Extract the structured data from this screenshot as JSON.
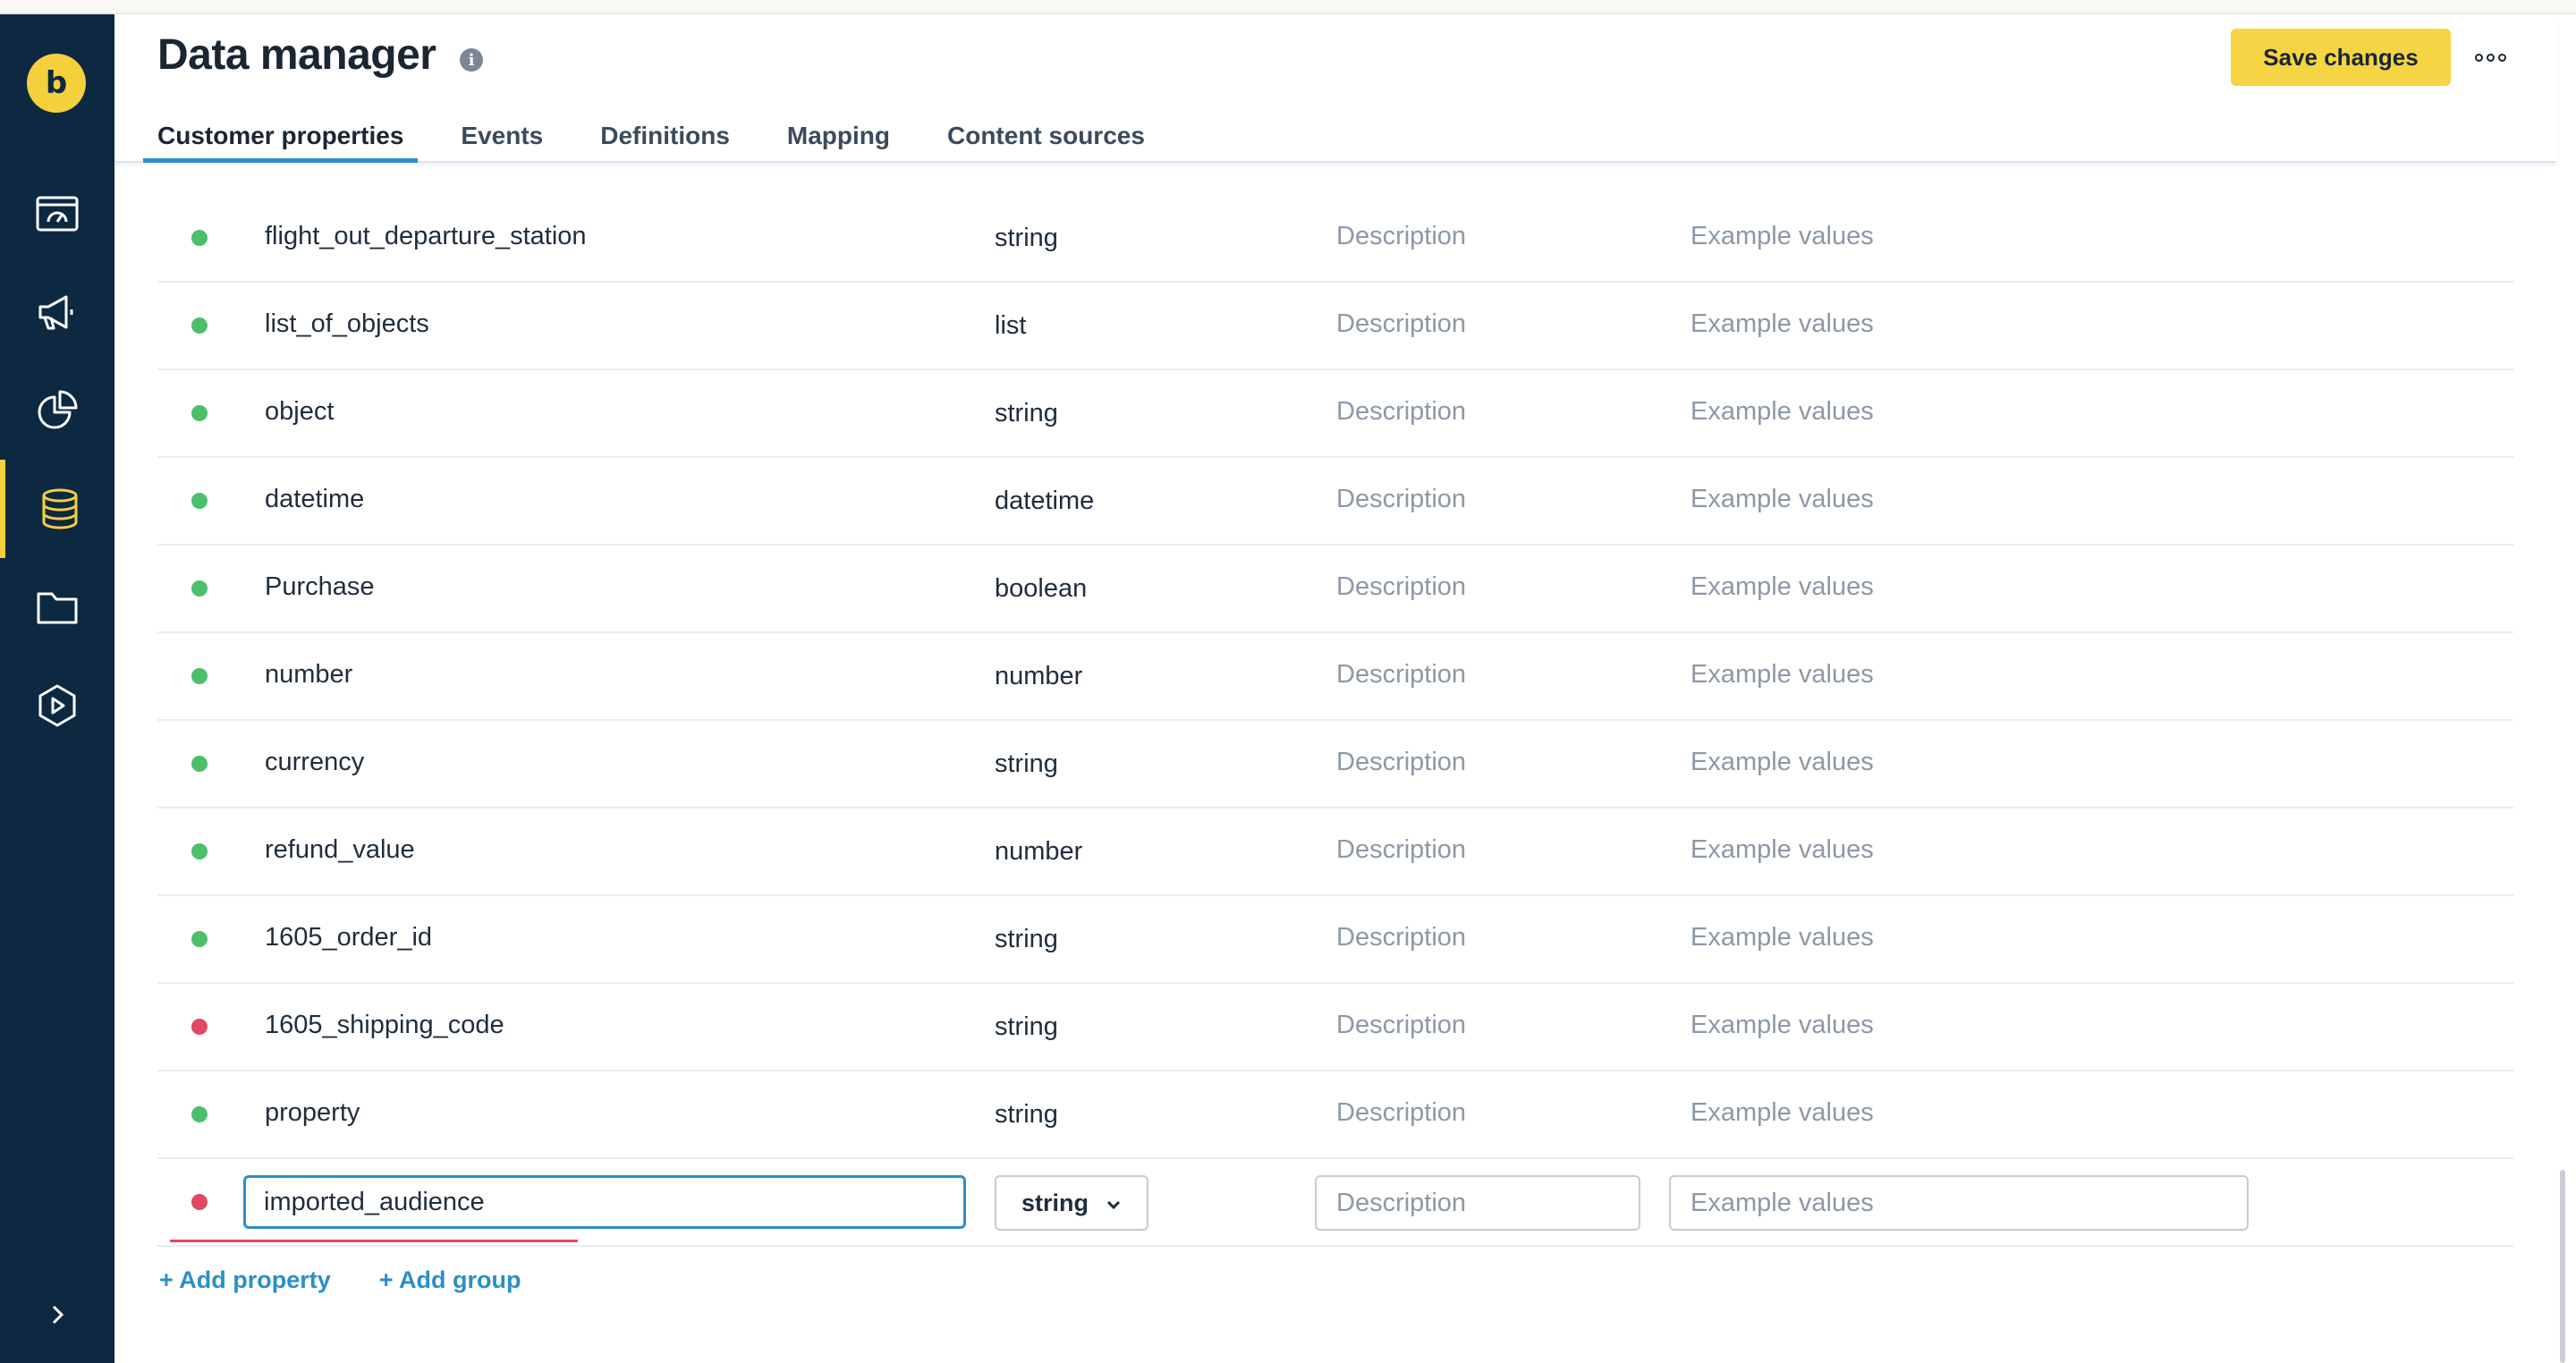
{
  "app": {
    "logo_letter": "b"
  },
  "header": {
    "title": "Data manager",
    "save_label": "Save changes"
  },
  "tabs": [
    {
      "label": "Customer properties",
      "active": true
    },
    {
      "label": "Events"
    },
    {
      "label": "Definitions"
    },
    {
      "label": "Mapping"
    },
    {
      "label": "Content sources"
    }
  ],
  "sidebar": {
    "items": [
      {
        "icon": "dashboard-icon"
      },
      {
        "icon": "megaphone-icon"
      },
      {
        "icon": "pie-chart-icon"
      },
      {
        "icon": "database-icon",
        "active": true
      },
      {
        "icon": "folder-icon"
      },
      {
        "icon": "play-hexagon-icon"
      }
    ],
    "collapse_icon": "chevron-right-icon"
  },
  "properties": [
    {
      "name": "flight_out_departure_station",
      "type": "string",
      "status": "valid",
      "description": "Description",
      "example": "Example values"
    },
    {
      "name": "list_of_objects",
      "type": "list",
      "status": "valid",
      "description": "Description",
      "example": "Example values"
    },
    {
      "name": "object",
      "type": "string",
      "status": "valid",
      "description": "Description",
      "example": "Example values"
    },
    {
      "name": "datetime",
      "type": "datetime",
      "status": "valid",
      "description": "Description",
      "example": "Example values"
    },
    {
      "name": "Purchase",
      "type": "boolean",
      "status": "valid",
      "description": "Description",
      "example": "Example values"
    },
    {
      "name": "number",
      "type": "number",
      "status": "valid",
      "description": "Description",
      "example": "Example values"
    },
    {
      "name": "currency",
      "type": "string",
      "status": "valid",
      "description": "Description",
      "example": "Example values"
    },
    {
      "name": "refund_value",
      "type": "number",
      "status": "valid",
      "description": "Description",
      "example": "Example values"
    },
    {
      "name": "1605_order_id",
      "type": "string",
      "status": "valid",
      "description": "Description",
      "example": "Example values"
    },
    {
      "name": "1605_shipping_code",
      "type": "string",
      "status": "error",
      "description": "Description",
      "example": "Example values"
    },
    {
      "name": "property",
      "type": "string",
      "status": "valid",
      "description": "Description",
      "example": "Example values"
    }
  ],
  "editing_row": {
    "name_value": "imported_audience",
    "type_value": "string",
    "description_placeholder": "Description",
    "example_placeholder": "Example values",
    "status": "error"
  },
  "actions": {
    "add_property": "+ Add property",
    "add_group": "+ Add group"
  },
  "colors": {
    "sidebar_bg": "#0d2841",
    "accent_yellow": "#f6d544",
    "link_blue": "#2b8fc9",
    "status_valid": "#4cbf6c",
    "status_error": "#e04863"
  }
}
